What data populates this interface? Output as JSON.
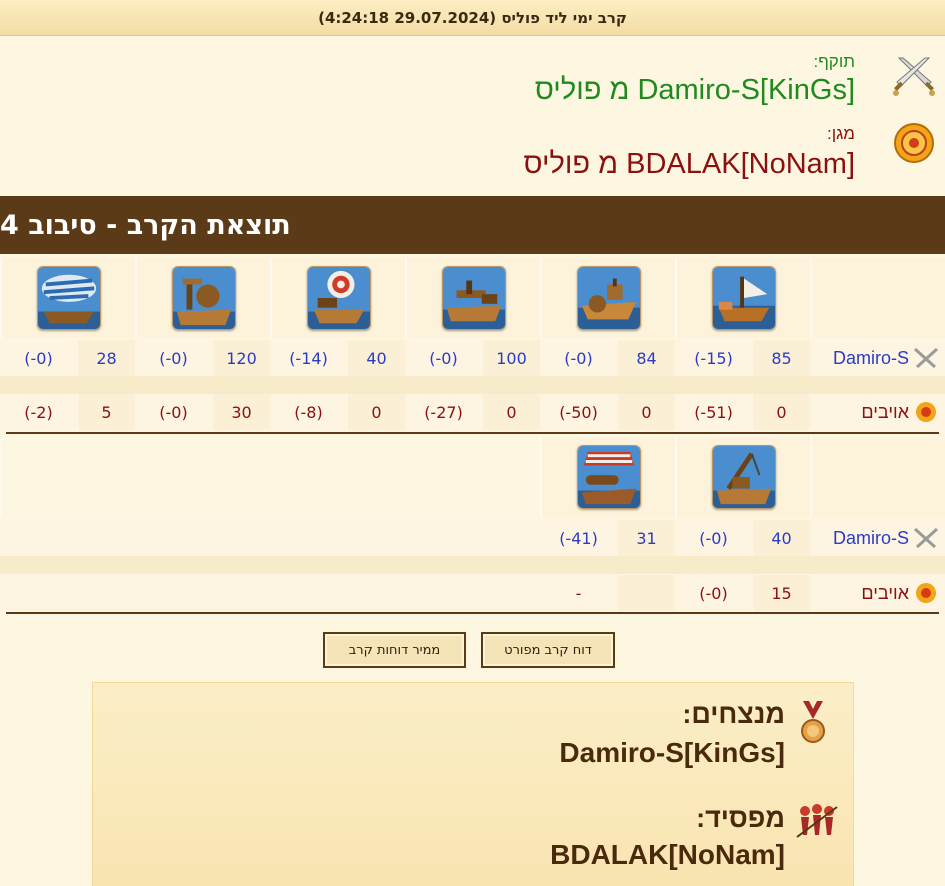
{
  "header": {
    "title": "קרב ימי ליד פוליס (29.07.2024 4:24:18)"
  },
  "attacker": {
    "label": "תוקף:",
    "name": "Damiro-S[KinGs] מ פוליס"
  },
  "defender": {
    "label": "מגן:",
    "name": "BDALAK[NoNam] מ פוליס"
  },
  "round": {
    "title": "תוצאת הקרב - סיבוב 4"
  },
  "section1": {
    "units": [
      "fire-ship",
      "paddle-ship",
      "mortar-ship",
      "ballista-ship",
      "catapult-ship",
      "balloon-carrier"
    ],
    "own": {
      "name": "Damiro-S",
      "cells": [
        {
          "n": "85",
          "l": "(15-)"
        },
        {
          "n": "84",
          "l": "(0-)"
        },
        {
          "n": "100",
          "l": "(0-)"
        },
        {
          "n": "40",
          "l": "(14-)"
        },
        {
          "n": "120",
          "l": "(0-)"
        },
        {
          "n": "28",
          "l": "(0-)"
        }
      ]
    },
    "enemy": {
      "name": "אויבים",
      "cells": [
        {
          "n": "0",
          "l": "(51-)"
        },
        {
          "n": "0",
          "l": "(50-)"
        },
        {
          "n": "0",
          "l": "(27-)"
        },
        {
          "n": "0",
          "l": "(8-)"
        },
        {
          "n": "30",
          "l": "(0-)"
        },
        {
          "n": "5",
          "l": "(2-)"
        }
      ]
    }
  },
  "section2": {
    "units": [
      "crane-ship",
      "cannon-ship"
    ],
    "own": {
      "name": "Damiro-S",
      "cells": [
        {
          "n": "40",
          "l": "(0-)"
        },
        {
          "n": "31",
          "l": "(41-)"
        }
      ]
    },
    "enemy": {
      "name": "אויבים",
      "cells": [
        {
          "n": "15",
          "l": "(0-)"
        },
        {
          "n": "",
          "l": "-"
        }
      ]
    }
  },
  "buttons": {
    "detailed": "דוח קרב מפורט",
    "converter": "ממיר דוחות קרב"
  },
  "result": {
    "winners_label": "מנצחים:",
    "winners": "Damiro-S[KinGs]",
    "loser_label": "מפסיד:",
    "loser": "BDALAK[NoNam]"
  },
  "colors": {
    "own": "#2a3cc4",
    "enemy": "#8b1010",
    "attacker": "#1f8a1f",
    "bar": "#5b3a17"
  }
}
